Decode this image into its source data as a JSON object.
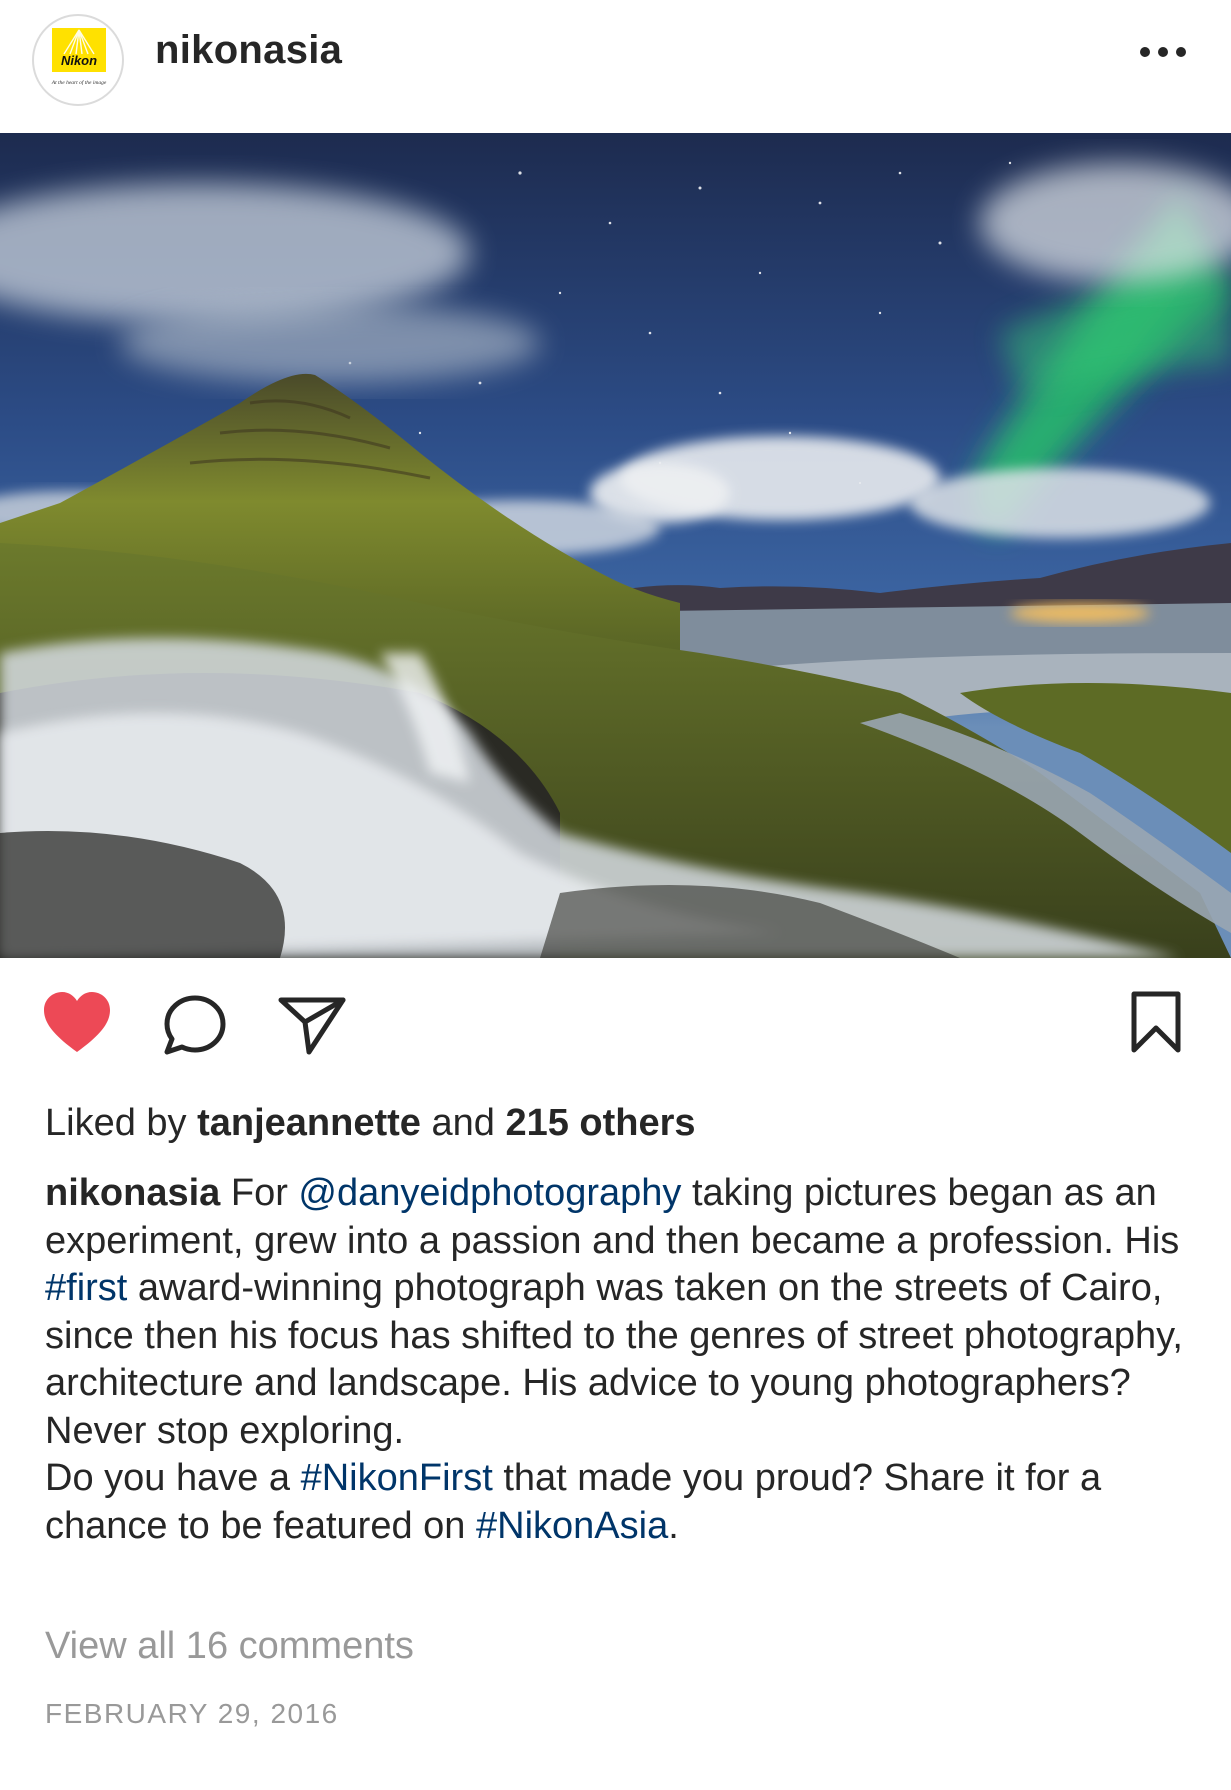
{
  "post": {
    "username": "nikonasia",
    "avatar_logo_text": "Nikon",
    "avatar_tagline": "At the heart of the image",
    "photo_alt": "Kirkjufell mountain and waterfall under aurora at night",
    "liked_by_prefix": "Liked by",
    "liked_by_user": "tanjeannette",
    "liked_by_and": "and",
    "liked_by_others": "215 others",
    "caption": {
      "author": "nikonasia",
      "p1_a": " For ",
      "mention": "@danyeidphotography",
      "p1_b": " taking pictures began as an experiment, grew into a passion and then became a profession. His ",
      "tag_first": "#first",
      "p1_c": " award-winning photograph was taken on the streets of Cairo, since then his focus has shifted to the genres of street photography, architecture and landscape. His advice to young photographers? Never stop exploring.",
      "p2_a": "Do you have a ",
      "tag_nikonfirst": "#NikonFirst",
      "p2_b": " that made you proud? Share it for a chance to be featured on ",
      "tag_nikonasia": "#NikonAsia",
      "p2_c": "."
    },
    "view_comments": "View all 16 comments",
    "date": "FEBRUARY 29, 2016"
  },
  "icons": {
    "more": "more-options-icon",
    "like": "heart-filled-icon",
    "comment": "comment-bubble-icon",
    "share": "paper-plane-icon",
    "save": "bookmark-icon"
  },
  "colors": {
    "heart": "#ed4956",
    "link": "#003569",
    "text": "#262626",
    "muted": "#999999",
    "nikon_yellow": "#ffe100"
  }
}
